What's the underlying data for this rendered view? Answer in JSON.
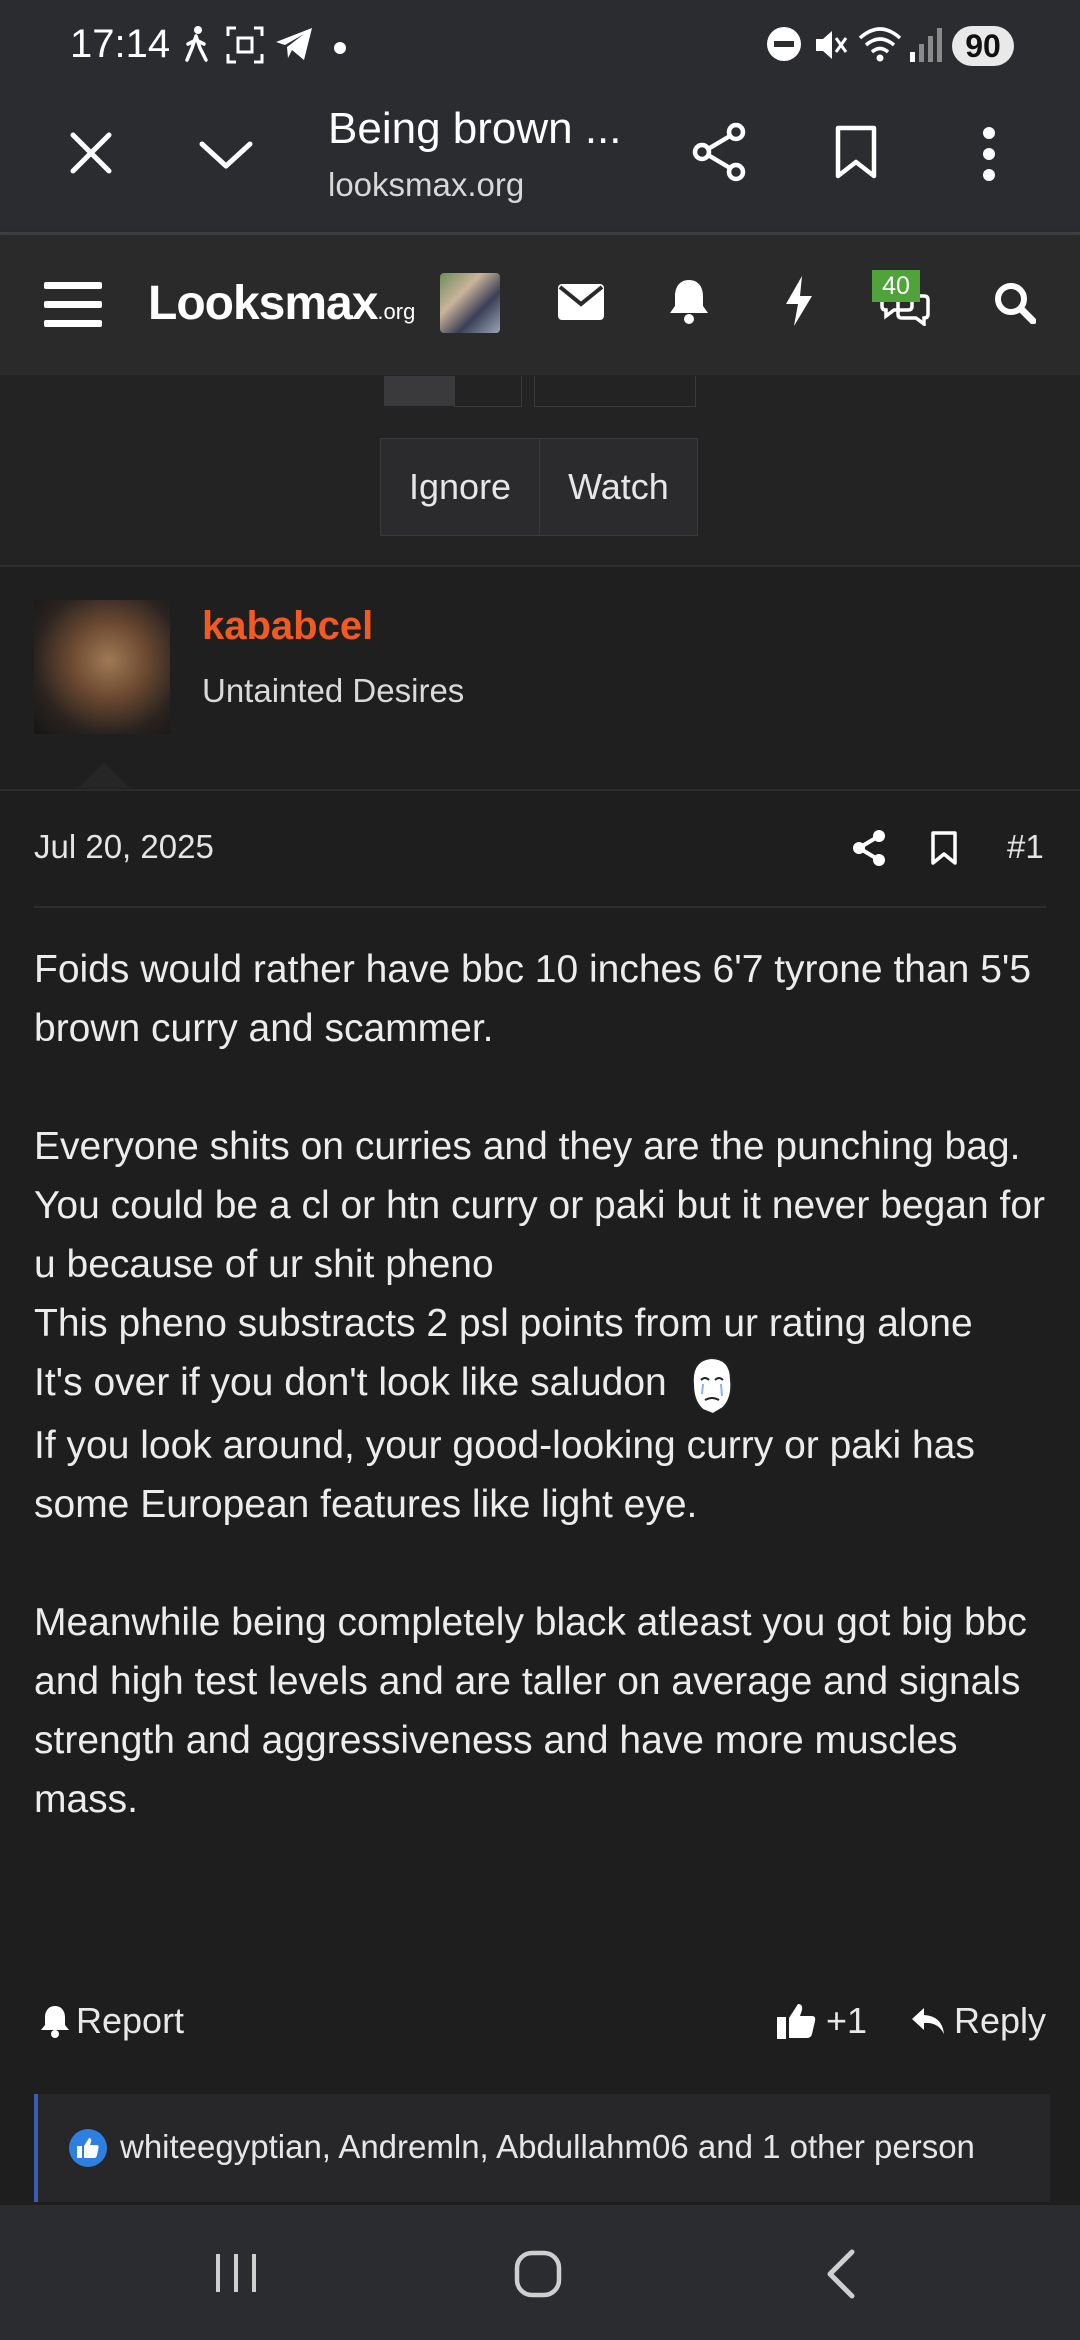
{
  "status_bar": {
    "time": "17:14",
    "battery": "90",
    "icons": [
      "walk-icon",
      "screenshot-icon",
      "telegram-icon",
      "dot-icon",
      "dnd-icon",
      "mute-icon",
      "wifi-icon",
      "signal-icon"
    ]
  },
  "browser": {
    "page_title": "Being brown ...",
    "domain": "looksmax.org",
    "icons": [
      "close-icon",
      "chevron-down-icon",
      "share-icon",
      "bookmark-icon",
      "more-vert-icon"
    ]
  },
  "site_nav": {
    "logo_main": "Looksmax",
    "logo_suffix": ".org",
    "chat_badge": "40",
    "icons": [
      "menu-icon",
      "mail-icon",
      "bell-icon",
      "lightning-icon",
      "chat-icon",
      "search-icon"
    ]
  },
  "thread_controls": {
    "ignore_label": "Ignore",
    "watch_label": "Watch"
  },
  "author": {
    "name": "kababcel",
    "title": "Untainted Desires",
    "name_color": "#f25a22"
  },
  "post": {
    "date": "Jul 20, 2025",
    "number": "#1",
    "lines": {
      "p1": "Foids would rather have bbc 10 inches 6'7 tyrone than 5'5 brown curry and scammer.",
      "p2": "Everyone shits on curries and they are the punching bag.",
      "p3": "You could be a cl or htn curry or paki but it never began for u because of ur shit pheno",
      "p4": "This pheno substracts 2 psl points from ur rating alone",
      "p5": "It's over if you don't look like saludon",
      "p6": "If you look around, your good-looking curry or paki has some European features like light eye.",
      "p7": "Meanwhile being completely black atleast you got big bbc and high test levels and are taller on average and signals strength and aggressiveness and have more muscles mass."
    },
    "report_label": "Report",
    "like_count": "+1",
    "reply_label": "Reply",
    "reactions_text": "whiteegyptian, Andremln, Abdullahm06 and 1 other person"
  },
  "android_nav": {
    "icons": [
      "recents-icon",
      "home-icon",
      "back-icon"
    ]
  }
}
